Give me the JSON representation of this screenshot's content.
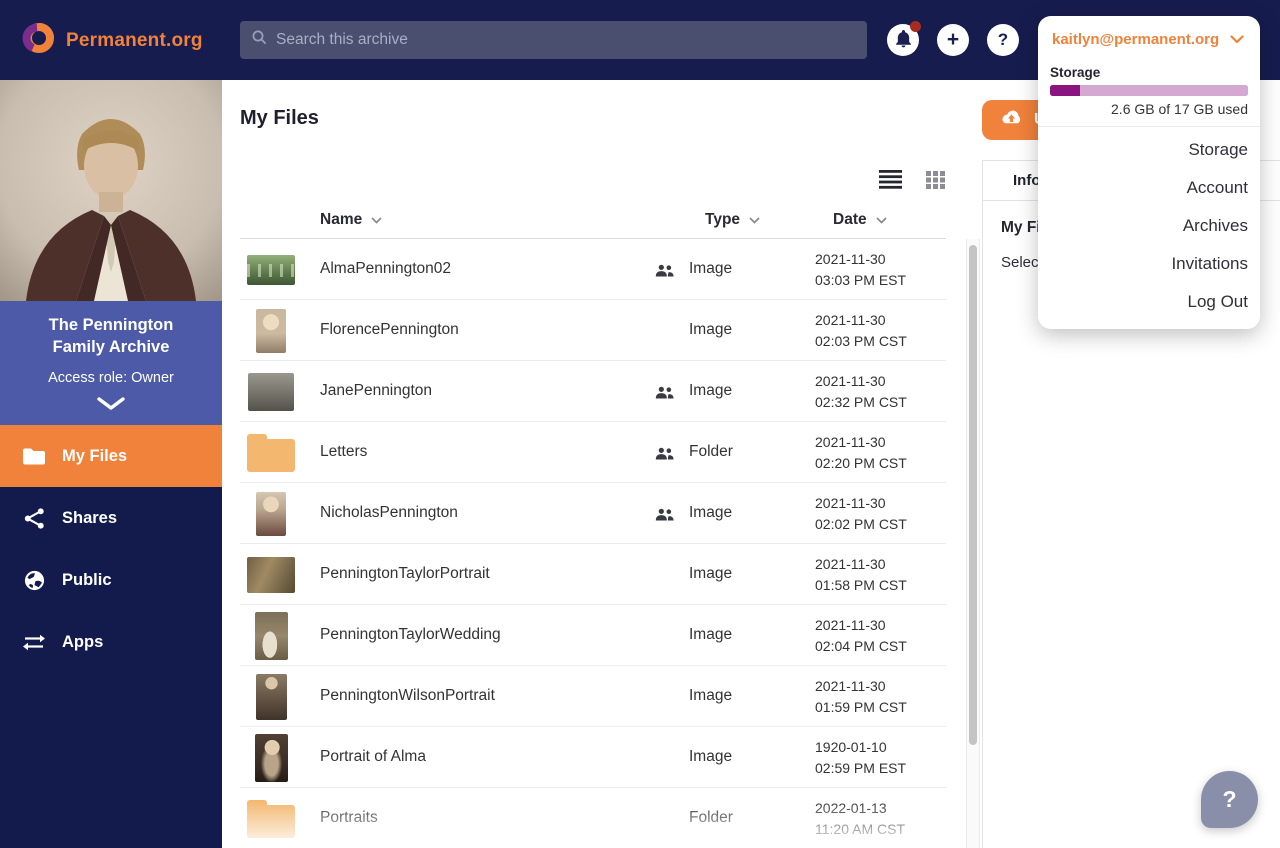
{
  "topbar": {
    "brand": "Permanent.org",
    "search_placeholder": "Search this archive",
    "notifications_badge": true
  },
  "account_menu": {
    "email": "kaitlyn@permanent.org",
    "storage_label": "Storage",
    "storage_used_text": "2.6 GB of 17 GB used",
    "storage_percent_used": 15.3,
    "items": [
      "Storage",
      "Account",
      "Archives",
      "Invitations",
      "Log Out"
    ]
  },
  "sidebar": {
    "archive_name": "The Pennington Family Archive",
    "access_role": "Access role: Owner",
    "nav": [
      {
        "label": "My Files",
        "icon": "folder-icon",
        "active": true
      },
      {
        "label": "Shares",
        "icon": "share-icon",
        "active": false
      },
      {
        "label": "Public",
        "icon": "globe-icon",
        "active": false
      },
      {
        "label": "Apps",
        "icon": "apps-icon",
        "active": false
      }
    ]
  },
  "main": {
    "title": "My Files",
    "upload_label": "Upload",
    "columns": [
      "Name",
      "Type",
      "Date"
    ],
    "rows": [
      {
        "name": "AlmaPennington02",
        "type": "Image",
        "date": "2021-11-30",
        "time": "03:03 PM EST",
        "shared": true,
        "thumb": "cemetery"
      },
      {
        "name": "FlorencePennington",
        "type": "Image",
        "date": "2021-11-30",
        "time": "02:03 PM CST",
        "shared": false,
        "thumb": "portrait-florence"
      },
      {
        "name": "JanePennington",
        "type": "Image",
        "date": "2021-11-30",
        "time": "02:32 PM CST",
        "shared": true,
        "thumb": "group-bw"
      },
      {
        "name": "Letters",
        "type": "Folder",
        "date": "2021-11-30",
        "time": "02:20 PM CST",
        "shared": true,
        "thumb": "folder"
      },
      {
        "name": "NicholasPennington",
        "type": "Image",
        "date": "2021-11-30",
        "time": "02:02 PM CST",
        "shared": true,
        "thumb": "portrait-nicholas"
      },
      {
        "name": "PenningtonTaylorPortrait",
        "type": "Image",
        "date": "2021-11-30",
        "time": "01:58 PM CST",
        "shared": false,
        "thumb": "couple-sepia"
      },
      {
        "name": "PenningtonTaylorWedding",
        "type": "Image",
        "date": "2021-11-30",
        "time": "02:04 PM CST",
        "shared": false,
        "thumb": "wedding"
      },
      {
        "name": "PenningtonWilsonPortrait",
        "type": "Image",
        "date": "2021-11-30",
        "time": "01:59 PM CST",
        "shared": false,
        "thumb": "portrait-wilson"
      },
      {
        "name": "Portrait of Alma",
        "type": "Image",
        "date": "1920-01-10",
        "time": "02:59 PM EST",
        "shared": false,
        "thumb": "portrait-alma"
      },
      {
        "name": "Portraits",
        "type": "Folder",
        "date": "2022-01-13",
        "time": "11:20 AM CST",
        "shared": false,
        "thumb": "folder"
      }
    ]
  },
  "info_panel": {
    "tab": "Info",
    "heading": "My Files",
    "hint": "Select"
  },
  "help_beacon": "?",
  "colors": {
    "brand_orange": "#f0823b",
    "navbar_navy": "#171c4f",
    "sidebar_navy": "#131b4d",
    "archive_blue": "#4d5aa8",
    "storage_fill_purple": "#8a1580",
    "storage_track_purple": "#d5a8d2",
    "notification_red": "#a72c20",
    "beacon_gray": "#8a8fa9"
  }
}
